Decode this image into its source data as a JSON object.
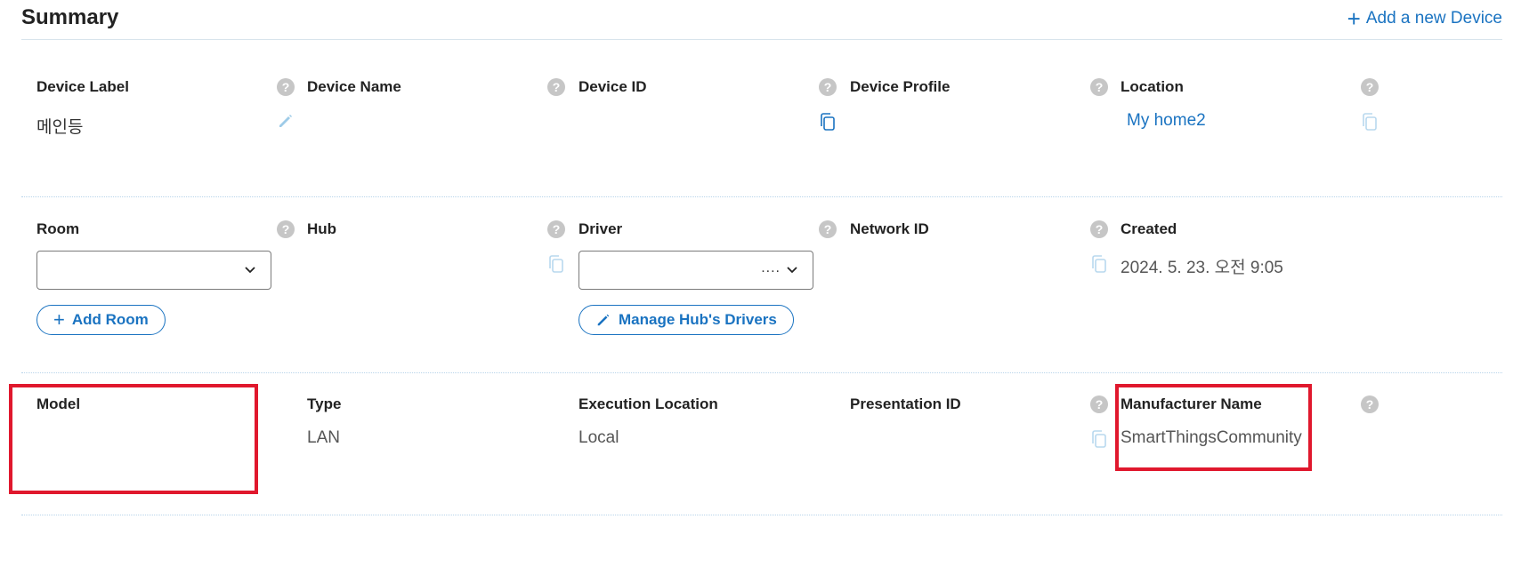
{
  "header": {
    "title": "Summary",
    "add_device": "Add a new Device"
  },
  "row1": {
    "device_label": {
      "label": "Device Label",
      "value": "메인등"
    },
    "device_name": {
      "label": "Device Name"
    },
    "device_id": {
      "label": "Device ID"
    },
    "device_profile": {
      "label": "Device Profile"
    },
    "location": {
      "label": "Location",
      "value": "My home2"
    }
  },
  "row2": {
    "room": {
      "label": "Room",
      "select_value": "",
      "add_button": "Add Room"
    },
    "hub": {
      "label": "Hub"
    },
    "driver": {
      "label": "Driver",
      "select_value": "....",
      "manage_button": "Manage Hub's Drivers"
    },
    "network_id": {
      "label": "Network ID"
    },
    "created": {
      "label": "Created",
      "value": "2024. 5. 23. 오전 9:05"
    }
  },
  "row3": {
    "model": {
      "label": "Model"
    },
    "type": {
      "label": "Type",
      "value": "LAN"
    },
    "execution_location": {
      "label": "Execution Location",
      "value": "Local"
    },
    "presentation_id": {
      "label": "Presentation ID"
    },
    "manufacturer_name": {
      "label": "Manufacturer Name",
      "value": "SmartThingsCommunity"
    }
  },
  "colors": {
    "accent": "#1a73c1",
    "highlight": "#e0182d",
    "help": "#c6c6c6"
  },
  "icons": [
    "plus-icon",
    "help-icon",
    "pencil-icon",
    "copy-icon",
    "chevron-down-icon"
  ]
}
